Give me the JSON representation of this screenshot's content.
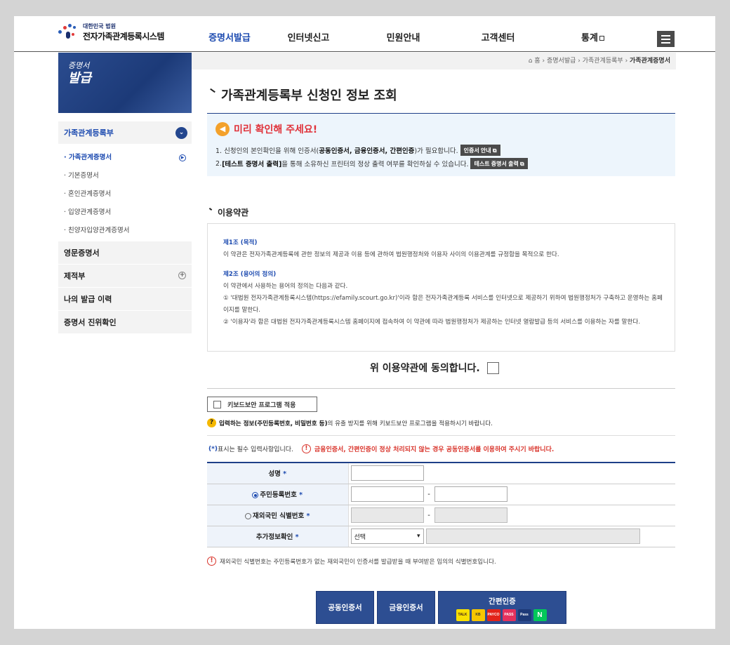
{
  "header": {
    "logo_sub": "대한민국 법원",
    "logo_main": "전자가족관계등록시스템",
    "nav": [
      "증명서발급",
      "인터넷신고",
      "민원안내",
      "고객센터",
      "통계"
    ]
  },
  "banner": {
    "line1": "증명서",
    "line2": "발급"
  },
  "breadcrumb": {
    "home": "홈",
    "c1": "증명서발급",
    "c2": "가족관계등록부",
    "current": "가족관계증명서"
  },
  "sidebar": {
    "group1": "가족관계등록부",
    "sub_items": [
      "· 가족관계증명서",
      "· 기본증명서",
      "· 혼인관계증명서",
      "· 입양관계증명서",
      "· 친양자입양관계증명서"
    ],
    "group2": "영문증명서",
    "group3": "제적부",
    "group4": "나의 발급 이력",
    "group5": "증명서 진위확인"
  },
  "page_title": "가족관계등록부 신청인 정보 조회",
  "notice": {
    "title": "미리 확인해 주세요!",
    "line1_a": "1. 신청인의 본인확인을 위해 인증서(",
    "line1_b": "공동인증서, 금융인증서, 간편인증",
    "line1_c": ")가 필요합니다.",
    "btn1": "인증서 안내",
    "line2_a": "2. ",
    "line2_b": "[테스트 증명서 출력]",
    "line2_c": "을 통해 소유하신 프린터의 정상 출력 여부를 확인하실 수 있습니다.",
    "btn2": "테스트 증명서 출력"
  },
  "terms": {
    "section_title": "이용약관",
    "art1_title": "제1조 (목적)",
    "art1_body": "이 약관은 전자가족관계등록에 관한 정보의 제공과 이용 등에 관하여 법원행정처와 이용자 사이의 이용관계를 규정함을 목적으로 한다.",
    "art2_title": "제2조 (용어의 정의)",
    "art2_body0": "이 약관에서 사용하는 용어의 정의는 다음과 같다.",
    "art2_body1": "① '대법원 전자가족관계등록시스템(https://efamily.scourt.go.kr)'이라 함은 전자가족관계등록 서비스를 인터넷으로 제공하기 위하여 법원행정처가 구축하고 운영하는 홈페이지를 말한다.",
    "art2_body2": "② '이용자'라 함은 대법원 전자가족관계등록시스템 홈페이지에 접속하여 이 약관에 따라 법원행정처가 제공하는 인터넷 열람발급 등의 서비스를 이용하는 자를 말한다.",
    "agree_label": "위 이용약관에 동의합니다."
  },
  "keyboard_btn": "키보드보안 프로그램 적용",
  "help_a": "입력하는 정보",
  "help_b": "(주민등록번호, 비밀번호 등)",
  "help_c": "의 유출 방지를 위해 키보드보안 프로그램을 적용하시기 바랍니다.",
  "req_note": "표시는 필수 입력사항입니다.",
  "req_star": "(*)",
  "req_warn": "금융인증서, 간편인증이 정상 처리되지 않는 경우 공동인증서를 이용하여 주시기 바랍니다.",
  "form": {
    "name_label": "성명",
    "rrn_label": "주민등록번호",
    "foreign_label": "재외국민 식별번호",
    "extra_label": "추가정보확인",
    "select_value": "선택",
    "star": "*",
    "dash": "-"
  },
  "foot_note": "재외국민 식별번호는 주민등록번호가 없는 재외국민이 인증서를 발급받을 때 부여받은 임의의 식별번호입니다.",
  "buttons": {
    "b1": "공동인증서",
    "b2": "금융인증서",
    "b3": "간편인증",
    "pay": [
      "TALK",
      "KB",
      "PAYCO",
      "PASS",
      "Pass",
      "N"
    ]
  },
  "colors": {
    "primary": "#2d4e92",
    "accent_red": "#e0323a",
    "notice_bg": "#edf5fc"
  }
}
